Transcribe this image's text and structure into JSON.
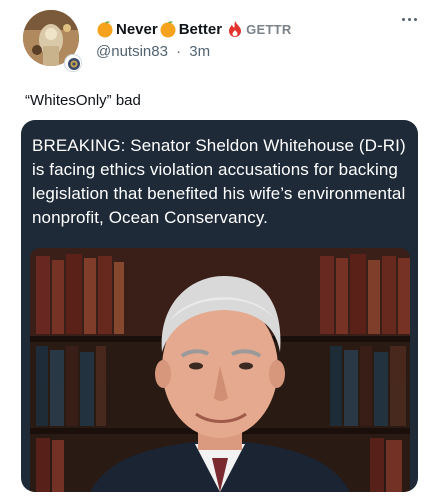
{
  "post": {
    "display_name": {
      "part1": "Never",
      "part2": "Better",
      "platform": "GETTR",
      "emoji": "orange-emoji"
    },
    "handle": "@nutsin83",
    "separator": "·",
    "time": "3m",
    "text": "“WhitesOnly” bad"
  },
  "card": {
    "headline": "BREAKING: Senator Sheldon Whitehouse (D-RI) is facing ethics violation accusations for backing legislation that benefited his wife’s environmental nonprofit, Ocean Conservancy."
  },
  "colors": {
    "card_bg": "#1e2a38",
    "orange": "#f6a21c",
    "gettr_red": "#e3342f",
    "secondary_text": "#536471"
  },
  "icons": [
    "orange-emoji",
    "gettr-flame-icon",
    "more-options-icon",
    "badge-icon"
  ]
}
